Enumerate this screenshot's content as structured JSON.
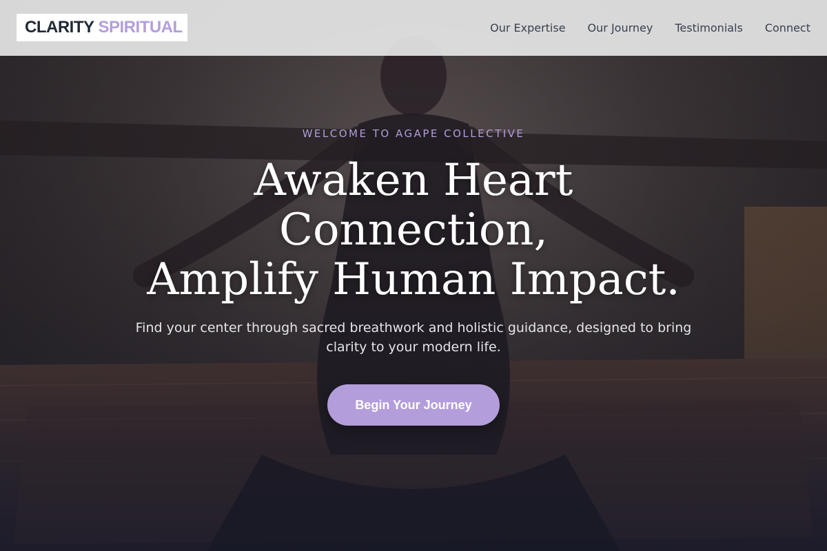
{
  "brand": {
    "name_primary": "CLARITY",
    "name_accent": "SPIRITUAL"
  },
  "nav": {
    "items": [
      {
        "label": "Our Expertise"
      },
      {
        "label": "Our Journey"
      },
      {
        "label": "Testimonials"
      },
      {
        "label": "Connect"
      }
    ]
  },
  "hero": {
    "eyebrow": "WELCOME TO AGAPE COLLECTIVE",
    "headline_lines": [
      "Awaken Heart",
      "Connection,",
      "Amplify Human Impact."
    ],
    "subtitle": "Find your center through sacred breathwork and holistic guidance, designed to bring clarity to your modern life.",
    "cta_label": "Begin Your Journey",
    "background_icon": "meditation-photo"
  },
  "colors": {
    "accent": "#b39ddb",
    "brand_dark": "#1f2937",
    "nav_text": "#374151",
    "headline": "#ffffff"
  }
}
